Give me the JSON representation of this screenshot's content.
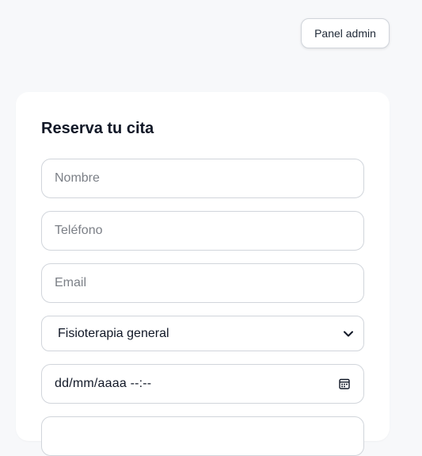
{
  "header": {
    "admin_button_label": "Panel admin"
  },
  "form": {
    "title": "Reserva tu cita",
    "name": {
      "placeholder": "Nombre",
      "value": ""
    },
    "phone": {
      "placeholder": "Teléfono",
      "value": ""
    },
    "email": {
      "placeholder": "Email",
      "value": ""
    },
    "service": {
      "selected": "Fisioterapia general"
    },
    "datetime": {
      "display": "dd/mm/aaaa  --:--"
    }
  },
  "icons": {
    "select_arrow": "chevron-down-icon",
    "datetime_picker": "calendar-icon"
  },
  "colors": {
    "background": "#f7f8fa",
    "card": "#ffffff",
    "border": "#d1d5db",
    "title": "#111827",
    "placeholder": "#7b7f86"
  }
}
